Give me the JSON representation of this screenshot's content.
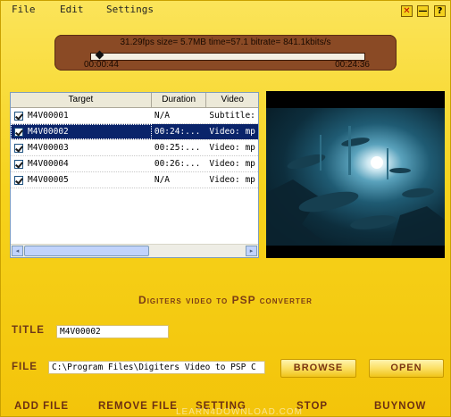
{
  "menu": {
    "file": "File",
    "edit": "Edit",
    "settings": "Settings"
  },
  "window_buttons": {
    "close": "✕",
    "minimize": "—",
    "help": "?"
  },
  "progress": {
    "stats": "31.29fps size=  5.7MB time=57.1 bitrate= 841.1kbits/s",
    "elapsed": "00:00:44",
    "total": "00:24:36",
    "position_fraction": 0.03
  },
  "list": {
    "columns": [
      "Target",
      "Duration",
      "Video"
    ],
    "rows": [
      {
        "target": "M4V00001",
        "duration": "N/A",
        "video": "Subtitle:",
        "checked": true,
        "selected": false
      },
      {
        "target": "M4V00002",
        "duration": "00:24:...",
        "video": "Video: mp",
        "checked": true,
        "selected": true
      },
      {
        "target": "M4V00003",
        "duration": "00:25:...",
        "video": "Video: mp",
        "checked": true,
        "selected": false
      },
      {
        "target": "M4V00004",
        "duration": "00:26:...",
        "video": "Video: mp",
        "checked": true,
        "selected": false
      },
      {
        "target": "M4V00005",
        "duration": "N/A",
        "video": "Video: mp",
        "checked": true,
        "selected": false
      }
    ],
    "scroll_left": "◂",
    "scroll_right": "▸"
  },
  "app_title": "Digiters video to PSP converter",
  "title_field": {
    "label": "TITLE",
    "value": "M4V00002"
  },
  "file_field": {
    "label": "FILE",
    "value": "C:\\Program Files\\Digiters Video to PSP C"
  },
  "buttons": {
    "browse": "BROWSE",
    "open": "OPEN"
  },
  "bottom": {
    "add_file": "ADD FILE",
    "remove_file": "REMOVE FILE",
    "setting": "SETTING",
    "stop": "STOP",
    "buynow": "BUYNOW"
  },
  "watermark": "LEARN4DOWNLOAD.COM",
  "colors": {
    "background": "#f6d31c",
    "progress_panel": "#8a4a25",
    "label_brown": "#6d3818",
    "selection": "#0a246a"
  }
}
